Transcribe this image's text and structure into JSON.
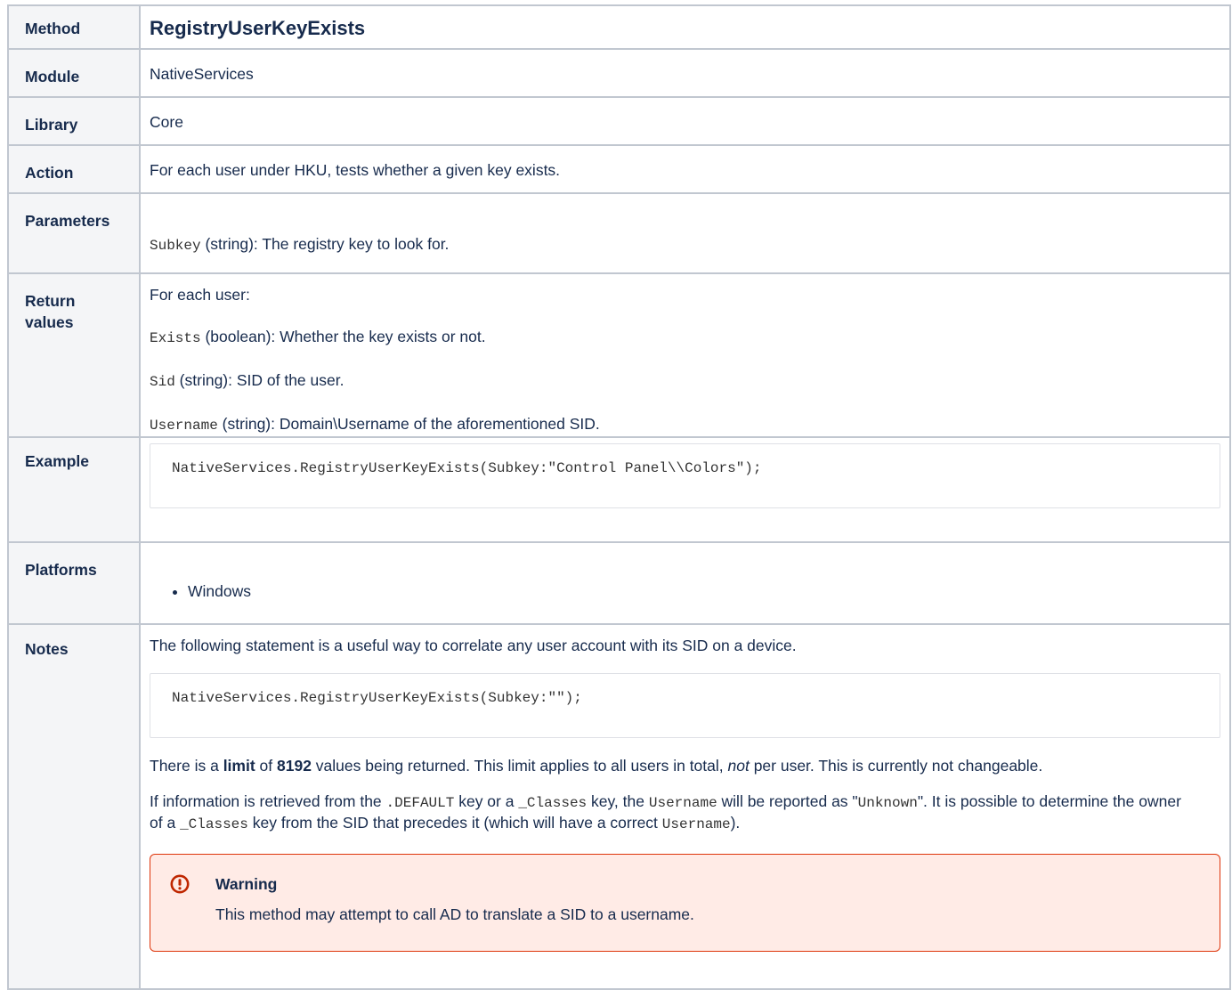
{
  "rows": {
    "method": {
      "label": "Method",
      "value": "RegistryUserKeyExists"
    },
    "module": {
      "label": "Module",
      "value": "NativeServices"
    },
    "library": {
      "label": "Library",
      "value": "Core"
    },
    "action": {
      "label": "Action",
      "value": "For each user under HKU, tests whether a given key exists."
    },
    "parameters": {
      "label": "Parameters",
      "code": "Subkey",
      "text": " (string): The registry key to look for."
    },
    "return_values": {
      "label": "Return values",
      "intro": "For each user:",
      "items": [
        {
          "code": "Exists",
          "text": " (boolean): Whether the key exists or not."
        },
        {
          "code": "Sid",
          "text": " (string): SID of the user."
        },
        {
          "code": "Username",
          "text": " (string): Domain\\Username of the aforementioned SID."
        }
      ]
    },
    "example": {
      "label": "Example",
      "code": "NativeServices.RegistryUserKeyExists(Subkey:\"Control Panel\\\\Colors\");"
    },
    "platforms": {
      "label": "Platforms",
      "items": [
        "Windows"
      ]
    },
    "notes": {
      "label": "Notes",
      "intro": "The following statement is a useful way to correlate any user account with its SID on a device.",
      "code": "NativeServices.RegistryUserKeyExists(Subkey:\"\");",
      "limit": {
        "t1": "There is a ",
        "b1": "limit",
        "t2": " of ",
        "b2": "8192",
        "t3": " values being returned. This limit applies to all users in total, ",
        "i1": "not",
        "t4": " per user. This is currently not changeable."
      },
      "info": {
        "t1": "If information is retrieved from the ",
        "c1": ".DEFAULT",
        "t2": " key or a ",
        "c2": "_Classes",
        "t3": " key, the ",
        "c3": "Username",
        "t4": " will be reported as \"",
        "c4": "Unknown",
        "t5": "\". It is possible to determine the owner of a ",
        "c5": "_Classes",
        "t6": " key from the SID that precedes it (which will have a correct ",
        "c6": "Username",
        "t7": ")."
      },
      "warning": {
        "title": "Warning",
        "body": "This method may attempt to call AD to translate a SID to a username."
      }
    }
  },
  "colors": {
    "border": "#c1c7d0",
    "label_bg": "#f4f5f7",
    "warning_border": "#de350b",
    "warning_bg": "#ffebe6",
    "warning_icon": "#bf2600"
  }
}
